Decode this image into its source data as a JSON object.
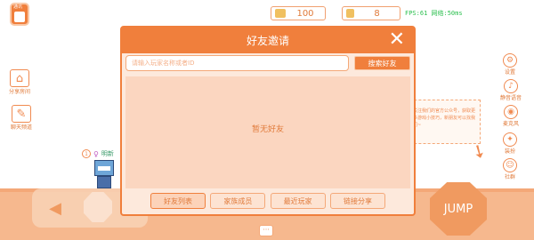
{
  "top": {
    "avatar_tag": "通讯",
    "resources": [
      {
        "icon": "coin-icon",
        "value": "100",
        "color": "#f0b040"
      },
      {
        "icon": "gem-icon",
        "value": "8",
        "color": "#f0b040"
      }
    ],
    "fps": "FPS:61 网络:50ms"
  },
  "left_buttons": [
    {
      "icon": "share-room-icon",
      "label": "分享房间"
    },
    {
      "icon": "chat-message-icon",
      "label": "聊天频道"
    }
  ],
  "right_buttons": [
    {
      "icon": "settings-icon",
      "label": "设置"
    },
    {
      "icon": "mute-sound-icon",
      "label": "静音语音"
    },
    {
      "icon": "microphone-icon",
      "label": "麦克风"
    },
    {
      "icon": "outfit-icon",
      "label": "装扮"
    },
    {
      "icon": "community-icon",
      "label": "社群"
    }
  ],
  "hint": {
    "text": "关注我们的官方公众号，获取更多游戏小技巧，新朋友可以找我们~"
  },
  "player": {
    "level": "1",
    "name": "明新"
  },
  "controls": {
    "jump_label": "JUMP",
    "chat_glyph": "···",
    "left_glyph": "◀"
  },
  "modal": {
    "title": "好友邀请",
    "close_glyph": "✕",
    "search_placeholder": "请输入玩家名称或者ID",
    "search_button": "搜索好友",
    "empty_text": "暂无好友",
    "tabs": [
      "好友列表",
      "家族成员",
      "最近玩家",
      "链接分享"
    ],
    "active_tab": 0
  }
}
